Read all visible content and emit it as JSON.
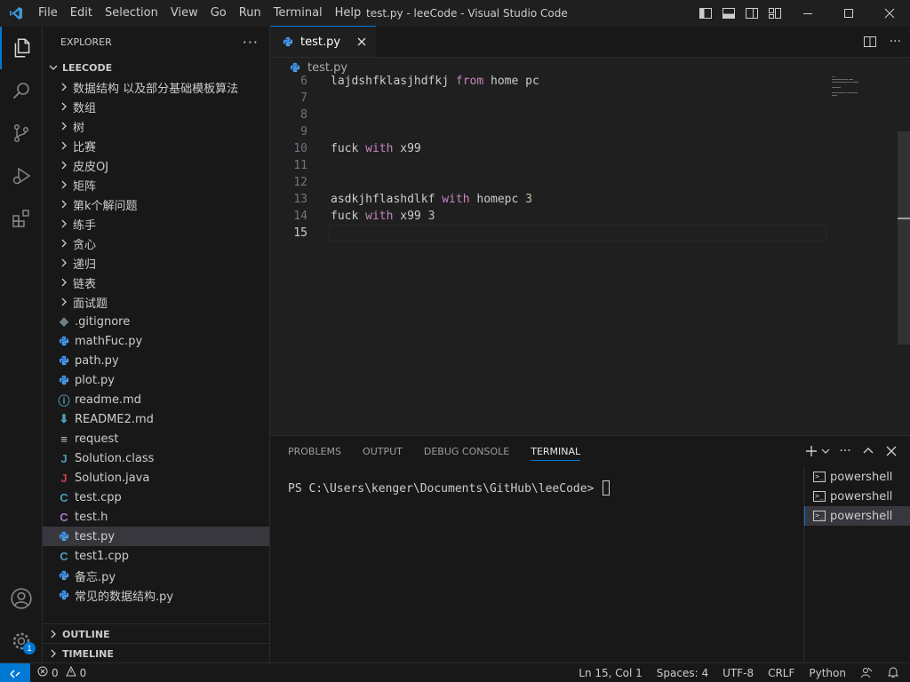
{
  "titlebar": {
    "menu": [
      "File",
      "Edit",
      "Selection",
      "View",
      "Go",
      "Run",
      "Terminal",
      "Help"
    ],
    "title": "test.py - leeCode - Visual Studio Code"
  },
  "sidebar": {
    "header": "EXPLORER",
    "more": "···",
    "project": "LEECODE",
    "folders": [
      "数据结构 以及部分基础模板算法",
      "数组",
      "树",
      "比赛",
      "皮皮OJ",
      "矩阵",
      "第k个解问题",
      "练手",
      "贪心",
      "递归",
      "链表",
      "面试题"
    ],
    "files": [
      {
        "name": ".gitignore",
        "icon": "gitignore-icon",
        "glyph": "◆",
        "color": "#6d8086"
      },
      {
        "name": "mathFuc.py",
        "icon": "python-icon",
        "glyph": "",
        "color": "#3b8eea"
      },
      {
        "name": "path.py",
        "icon": "python-icon",
        "glyph": "",
        "color": "#3b8eea"
      },
      {
        "name": "plot.py",
        "icon": "python-icon",
        "glyph": "",
        "color": "#3b8eea"
      },
      {
        "name": "readme.md",
        "icon": "info-icon",
        "glyph": "ⓘ",
        "color": "#519aba"
      },
      {
        "name": "README2.md",
        "icon": "download-icon",
        "glyph": "⬇",
        "color": "#519aba"
      },
      {
        "name": "request",
        "icon": "lines-icon",
        "glyph": "≡",
        "color": "#cccccc"
      },
      {
        "name": "Solution.class",
        "icon": "java-icon",
        "glyph": "J",
        "color": "#519aba"
      },
      {
        "name": "Solution.java",
        "icon": "java-icon",
        "glyph": "J",
        "color": "#cc3e44"
      },
      {
        "name": "test.cpp",
        "icon": "cpp-icon",
        "glyph": "C",
        "color": "#519aba"
      },
      {
        "name": "test.h",
        "icon": "c-header-icon",
        "glyph": "C",
        "color": "#a074c4"
      },
      {
        "name": "test.py",
        "icon": "python-icon",
        "glyph": "",
        "color": "#3b8eea",
        "selected": true
      },
      {
        "name": "test1.cpp",
        "icon": "cpp-icon",
        "glyph": "C",
        "color": "#519aba"
      },
      {
        "name": "备忘.py",
        "icon": "python-icon",
        "glyph": "",
        "color": "#3b8eea"
      },
      {
        "name": "常见的数据结构.py",
        "icon": "python-icon",
        "glyph": "",
        "color": "#3b8eea"
      }
    ],
    "outline": "OUTLINE",
    "timeline": "TIMELINE"
  },
  "activity": {
    "settings_badge": "1"
  },
  "editor": {
    "tab": "test.py",
    "breadcrumb": "test.py",
    "lines": [
      {
        "n": "6",
        "parts": [
          [
            "lajdshfklasjhdfkj ",
            ""
          ],
          [
            "from",
            "kw"
          ],
          [
            " home pc",
            ""
          ]
        ]
      },
      {
        "n": "7",
        "parts": []
      },
      {
        "n": "8",
        "parts": []
      },
      {
        "n": "9",
        "parts": []
      },
      {
        "n": "10",
        "parts": [
          [
            "fuck ",
            ""
          ],
          [
            "with",
            "kw"
          ],
          [
            " x99",
            ""
          ]
        ]
      },
      {
        "n": "11",
        "parts": []
      },
      {
        "n": "12",
        "parts": []
      },
      {
        "n": "13",
        "parts": [
          [
            "asdkjhflashdlkf ",
            ""
          ],
          [
            "with",
            "kw"
          ],
          [
            " homepc ",
            ""
          ],
          [
            "3",
            "num"
          ]
        ]
      },
      {
        "n": "14",
        "parts": [
          [
            "fuck ",
            ""
          ],
          [
            "with",
            "kw"
          ],
          [
            " x99 ",
            ""
          ],
          [
            "3",
            "num"
          ]
        ]
      },
      {
        "n": "15",
        "parts": [],
        "current": true
      }
    ]
  },
  "panel": {
    "tabs": [
      "PROBLEMS",
      "OUTPUT",
      "DEBUG CONSOLE",
      "TERMINAL"
    ],
    "active_tab": "TERMINAL",
    "prompt": "PS C:\\Users\\kenger\\Documents\\GitHub\\leeCode> ",
    "terminals": [
      "powershell",
      "powershell",
      "powershell"
    ]
  },
  "statusbar": {
    "errors": "0",
    "warnings": "0",
    "position": "Ln 15, Col 1",
    "spaces": "Spaces: 4",
    "encoding": "UTF-8",
    "eol": "CRLF",
    "language": "Python"
  },
  "colors": {
    "accent": "#0078d4",
    "keyword": "#c586c0",
    "number": "#b5cea8",
    "python": "#3b8eea"
  }
}
